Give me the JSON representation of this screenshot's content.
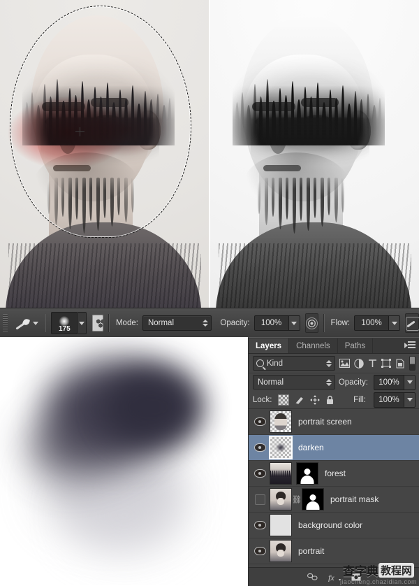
{
  "app": "Adobe Photoshop",
  "options_bar": {
    "tool_icon": "brush-icon",
    "tool_preset_caret": "▾",
    "brush_size": "175",
    "brush_panel_toggle_icon": "brush-panel-icon",
    "mode_label": "Mode:",
    "mode_value": "Normal",
    "opacity_label": "Opacity:",
    "opacity_value": "100%",
    "airbrush_icon": "airbrush-icon",
    "flow_label": "Flow:",
    "flow_value": "100%",
    "pressure_icon": "tablet-pressure-icon"
  },
  "layers_panel": {
    "tabs": [
      {
        "label": "Layers",
        "active": true
      },
      {
        "label": "Channels",
        "active": false
      },
      {
        "label": "Paths",
        "active": false
      }
    ],
    "menu_icon": "panel-menu-icon",
    "filter": {
      "search_icon": "search-icon",
      "kind_value": "Kind",
      "icons": [
        "pixel-filter-icon",
        "adjustment-filter-icon",
        "type-filter-icon",
        "shape-filter-icon",
        "smart-object-filter-icon"
      ],
      "toggle_icon": "filter-toggle-icon"
    },
    "blend_mode": "Normal",
    "opacity_label": "Opacity:",
    "opacity_value": "100%",
    "lock_label": "Lock:",
    "lock_icons": [
      "lock-transparency-icon",
      "lock-image-icon",
      "lock-position-icon",
      "lock-all-icon"
    ],
    "fill_label": "Fill:",
    "fill_value": "100%",
    "layers": [
      {
        "name": "portrait screen",
        "visible": true,
        "selected": false,
        "thumb": "portrait-transparent",
        "mask": false,
        "linked": false
      },
      {
        "name": "darken",
        "visible": true,
        "selected": true,
        "thumb": "blob-transparent",
        "mask": false,
        "linked": false
      },
      {
        "name": "forest",
        "visible": true,
        "selected": false,
        "thumb": "forest",
        "mask": true,
        "linked": false
      },
      {
        "name": "portrait mask",
        "visible": false,
        "selected": false,
        "thumb": "portrait",
        "mask": true,
        "linked": true
      },
      {
        "name": "background color",
        "visible": true,
        "selected": false,
        "thumb": "gray-swatch",
        "mask": false,
        "linked": false
      },
      {
        "name": "portrait",
        "visible": true,
        "selected": false,
        "thumb": "portrait",
        "mask": false,
        "linked": false
      }
    ],
    "footer_icons": [
      "link-layers-icon",
      "layer-style-fx-icon",
      "add-mask-icon"
    ]
  },
  "watermark": {
    "text_dark": "查字典",
    "text_boxed": "教程网",
    "url": "jiaocheng.chazidian.com"
  },
  "colors": {
    "panel_bg": "#454545",
    "selection_blue": "#6d84a3",
    "quick_mask_red": "#d62826",
    "canvas_bg": "#e7e5e2"
  }
}
